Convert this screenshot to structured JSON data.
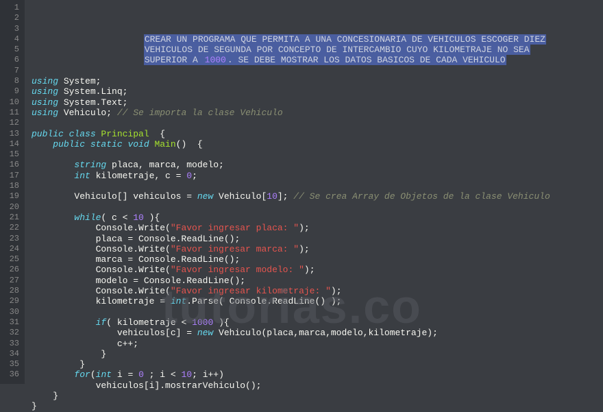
{
  "watermark": "tutorias.co",
  "lines": [
    {
      "n": 1,
      "segs": [
        {
          "t": "                     ",
          "c": ""
        },
        {
          "t": "CREAR UN PROGRAMA QUE PERMITA A UNA CONCESIONARIA DE VEHICULOS ESCOGER DIEZ",
          "c": "sel"
        }
      ]
    },
    {
      "n": 2,
      "segs": [
        {
          "t": "                     ",
          "c": ""
        },
        {
          "t": "VEHICULOS DE SEGUNDA POR CONCEPTO DE INTERCAMBIO CUYO KILOMETRAJE NO SEA",
          "c": "sel"
        }
      ]
    },
    {
      "n": 3,
      "segs": [
        {
          "t": "                     ",
          "c": ""
        },
        {
          "t": "SUPERIOR A ",
          "c": "sel"
        },
        {
          "t": "1000",
          "c": "sel num"
        },
        {
          "t": ". SE DEBE MOSTRAR LOS DATOS BASICOS DE CADA VEHICULO",
          "c": "sel"
        }
      ]
    },
    {
      "n": 4,
      "segs": []
    },
    {
      "n": 5,
      "segs": [
        {
          "t": "using",
          "c": "kw"
        },
        {
          "t": " System;",
          "c": "normal"
        }
      ]
    },
    {
      "n": 6,
      "segs": [
        {
          "t": "using",
          "c": "kw"
        },
        {
          "t": " System.Linq;",
          "c": "normal"
        }
      ]
    },
    {
      "n": 7,
      "segs": [
        {
          "t": "using",
          "c": "kw"
        },
        {
          "t": " System.Text;",
          "c": "normal"
        }
      ]
    },
    {
      "n": 8,
      "segs": [
        {
          "t": "using",
          "c": "kw"
        },
        {
          "t": " Vehiculo; ",
          "c": "normal"
        },
        {
          "t": "// Se importa la clase Vehiculo",
          "c": "comment"
        }
      ]
    },
    {
      "n": 9,
      "segs": []
    },
    {
      "n": 10,
      "segs": [
        {
          "t": "public class ",
          "c": "kw"
        },
        {
          "t": "Principal",
          "c": "type"
        },
        {
          "t": "  {",
          "c": "normal"
        }
      ]
    },
    {
      "n": 11,
      "segs": [
        {
          "t": "    ",
          "c": ""
        },
        {
          "t": "public static ",
          "c": "kw"
        },
        {
          "t": "void ",
          "c": "kw"
        },
        {
          "t": "Main",
          "c": "fn"
        },
        {
          "t": "()  {",
          "c": "normal"
        }
      ]
    },
    {
      "n": 12,
      "segs": []
    },
    {
      "n": 13,
      "segs": [
        {
          "t": "        ",
          "c": ""
        },
        {
          "t": "string",
          "c": "kw"
        },
        {
          "t": " placa, marca, modelo;",
          "c": "normal"
        }
      ]
    },
    {
      "n": 14,
      "segs": [
        {
          "t": "        ",
          "c": ""
        },
        {
          "t": "int",
          "c": "kw"
        },
        {
          "t": " kilometraje, c = ",
          "c": "normal"
        },
        {
          "t": "0",
          "c": "num"
        },
        {
          "t": ";",
          "c": "normal"
        }
      ]
    },
    {
      "n": 15,
      "segs": []
    },
    {
      "n": 16,
      "segs": [
        {
          "t": "        Vehiculo[] vehiculos = ",
          "c": "normal"
        },
        {
          "t": "new",
          "c": "kw"
        },
        {
          "t": " Vehiculo[",
          "c": "normal"
        },
        {
          "t": "10",
          "c": "num"
        },
        {
          "t": "]; ",
          "c": "normal"
        },
        {
          "t": "// Se crea Array de Objetos de la clase Vehiculo",
          "c": "comment"
        }
      ]
    },
    {
      "n": 17,
      "segs": []
    },
    {
      "n": 18,
      "segs": [
        {
          "t": "        ",
          "c": ""
        },
        {
          "t": "while",
          "c": "kw"
        },
        {
          "t": "( c < ",
          "c": "normal"
        },
        {
          "t": "10",
          "c": "num"
        },
        {
          "t": " ){",
          "c": "normal"
        }
      ]
    },
    {
      "n": 19,
      "segs": [
        {
          "t": "            Console.Write(",
          "c": "normal"
        },
        {
          "t": "\"Favor ingresar placa: \"",
          "c": "str"
        },
        {
          "t": ");",
          "c": "normal"
        }
      ]
    },
    {
      "n": 20,
      "segs": [
        {
          "t": "            placa = Console.ReadLine();",
          "c": "normal"
        }
      ]
    },
    {
      "n": 21,
      "segs": [
        {
          "t": "            Console.Write(",
          "c": "normal"
        },
        {
          "t": "\"Favor ingresar marca: \"",
          "c": "str"
        },
        {
          "t": ");",
          "c": "normal"
        }
      ]
    },
    {
      "n": 22,
      "segs": [
        {
          "t": "            marca = Console.ReadLine();",
          "c": "normal"
        }
      ]
    },
    {
      "n": 23,
      "segs": [
        {
          "t": "            Console.Write(",
          "c": "normal"
        },
        {
          "t": "\"Favor ingresar modelo: \"",
          "c": "str"
        },
        {
          "t": ");",
          "c": "normal"
        }
      ]
    },
    {
      "n": 24,
      "segs": [
        {
          "t": "            modelo = Console.ReadLine();",
          "c": "normal"
        }
      ]
    },
    {
      "n": 25,
      "segs": [
        {
          "t": "            Console.Write(",
          "c": "normal"
        },
        {
          "t": "\"Favor ingresar kilometraje: \"",
          "c": "str"
        },
        {
          "t": ");",
          "c": "normal"
        }
      ]
    },
    {
      "n": 26,
      "segs": [
        {
          "t": "            kilometraje = ",
          "c": "normal"
        },
        {
          "t": "int",
          "c": "kw"
        },
        {
          "t": ".Parse( Console.ReadLine() );",
          "c": "normal"
        }
      ]
    },
    {
      "n": 27,
      "segs": []
    },
    {
      "n": 28,
      "segs": [
        {
          "t": "            ",
          "c": ""
        },
        {
          "t": "if",
          "c": "kw"
        },
        {
          "t": "( kilometraje < ",
          "c": "normal"
        },
        {
          "t": "1000",
          "c": "num"
        },
        {
          "t": " ){",
          "c": "normal"
        }
      ]
    },
    {
      "n": 29,
      "segs": [
        {
          "t": "                vehiculos[c] = ",
          "c": "normal"
        },
        {
          "t": "new",
          "c": "kw"
        },
        {
          "t": " Vehiculo(placa,marca,modelo,kilometraje);",
          "c": "normal"
        }
      ]
    },
    {
      "n": 30,
      "segs": [
        {
          "t": "                c++;",
          "c": "normal"
        }
      ]
    },
    {
      "n": 31,
      "segs": [
        {
          "t": "             }",
          "c": "normal"
        }
      ]
    },
    {
      "n": 32,
      "segs": [
        {
          "t": "         }",
          "c": "normal"
        }
      ]
    },
    {
      "n": 33,
      "segs": [
        {
          "t": "        ",
          "c": ""
        },
        {
          "t": "for",
          "c": "kw"
        },
        {
          "t": "(",
          "c": "normal"
        },
        {
          "t": "int",
          "c": "kw"
        },
        {
          "t": " i = ",
          "c": "normal"
        },
        {
          "t": "0",
          "c": "num"
        },
        {
          "t": " ; i < ",
          "c": "normal"
        },
        {
          "t": "10",
          "c": "num"
        },
        {
          "t": "; i++)",
          "c": "normal"
        }
      ]
    },
    {
      "n": 34,
      "segs": [
        {
          "t": "            vehiculos[i].mostrarVehiculo();",
          "c": "normal"
        }
      ]
    },
    {
      "n": 35,
      "segs": [
        {
          "t": "    }",
          "c": "normal"
        }
      ]
    },
    {
      "n": 36,
      "segs": [
        {
          "t": "}",
          "c": "normal"
        }
      ]
    }
  ]
}
